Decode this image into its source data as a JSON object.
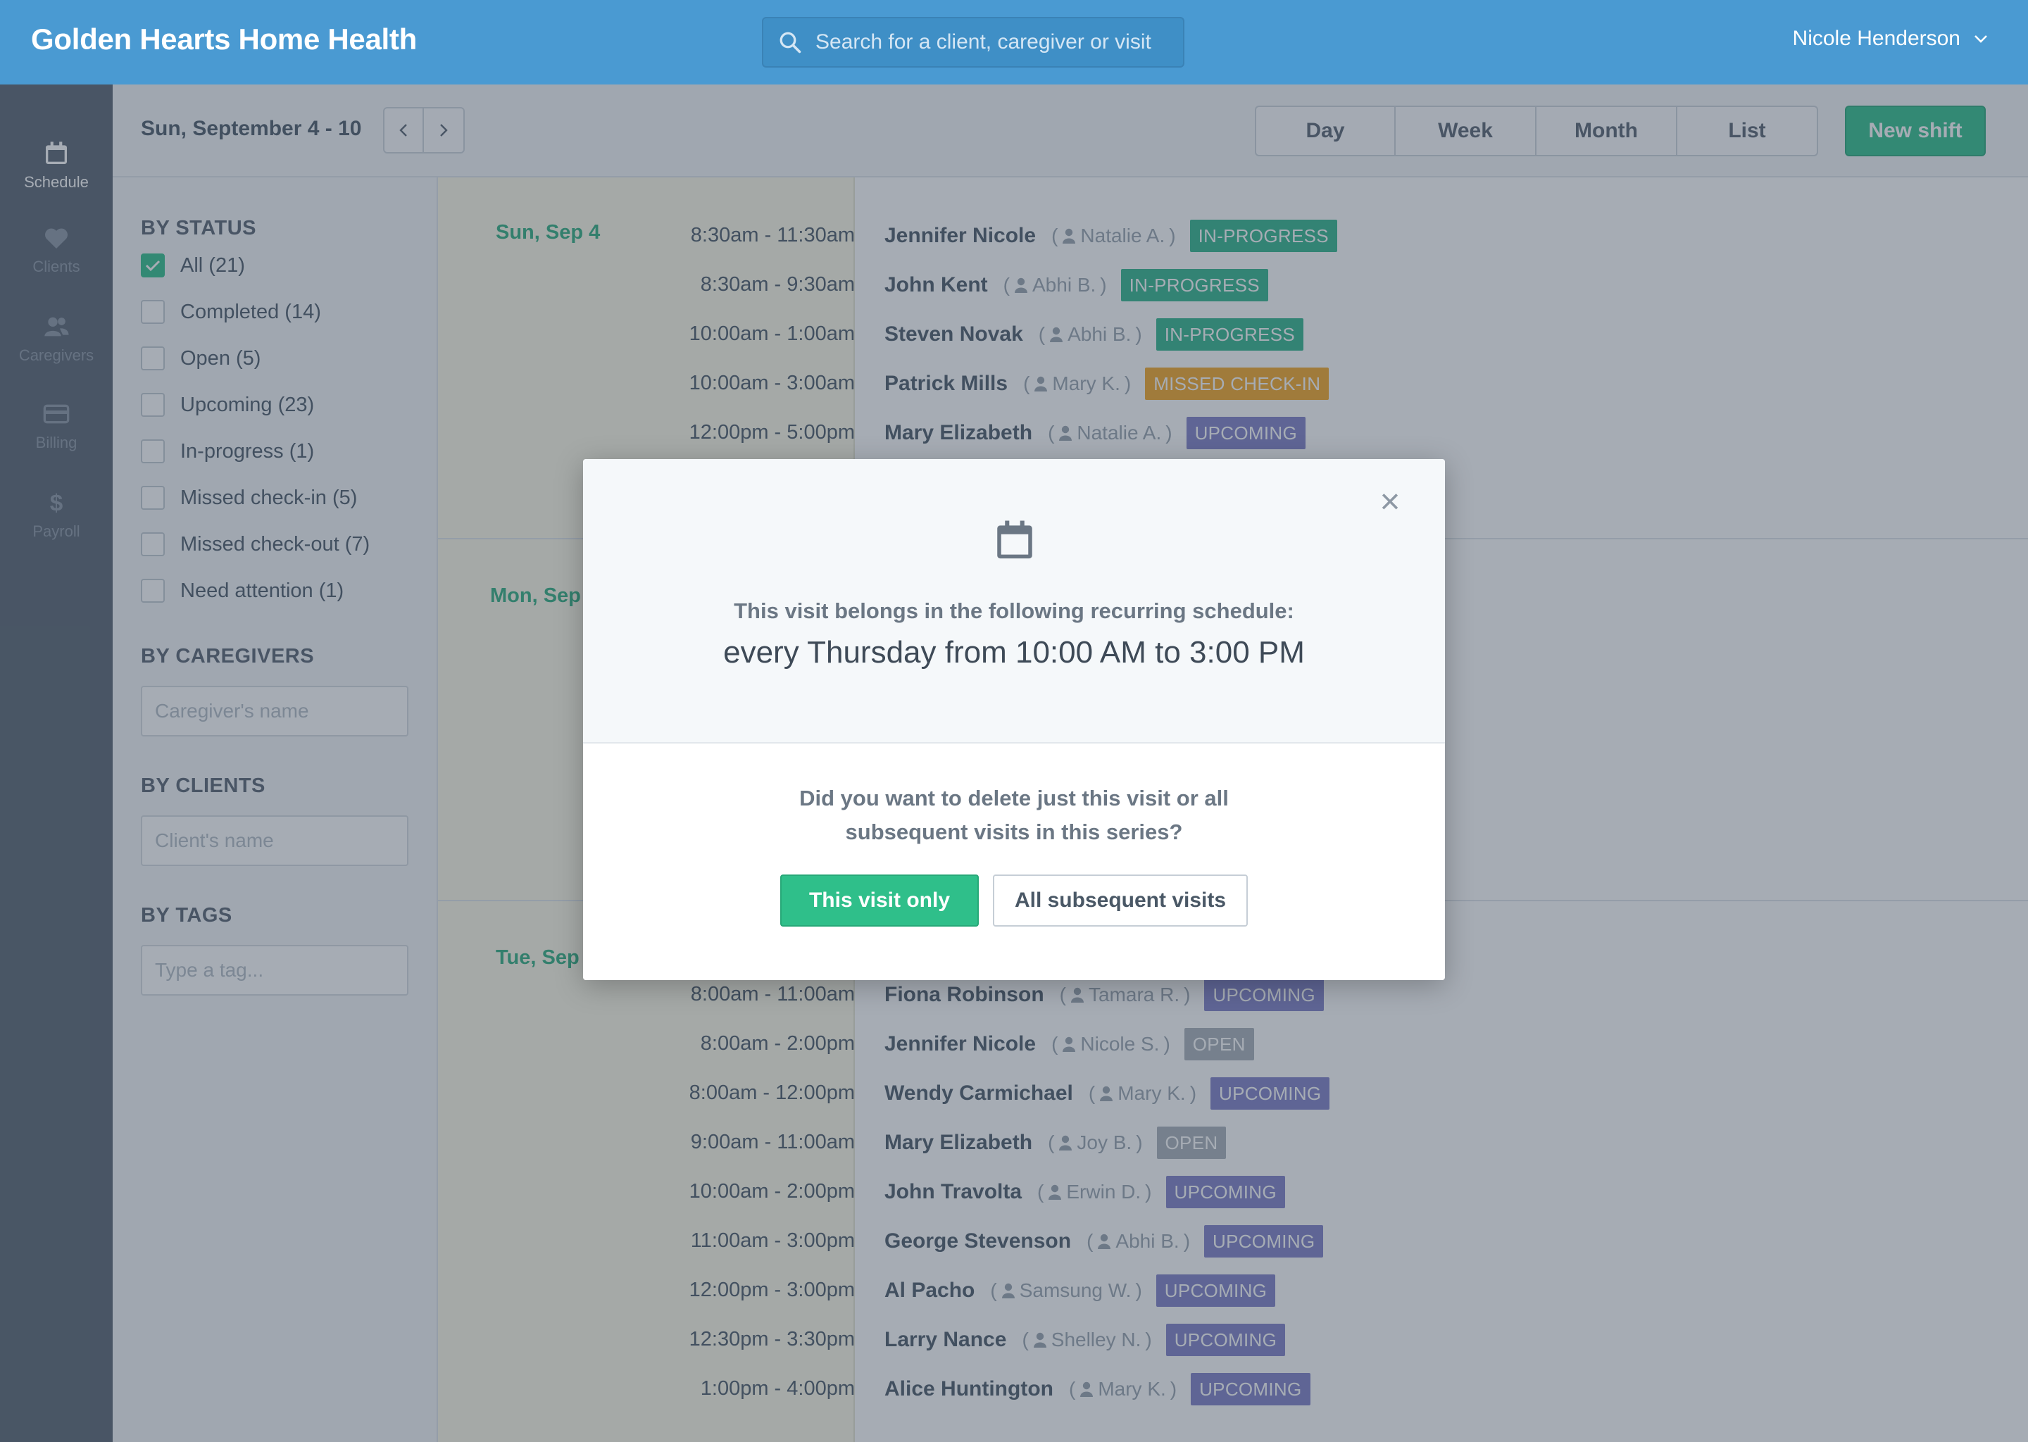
{
  "header": {
    "brand": "Golden Hearts Home Health",
    "search_placeholder": "Search for a client, caregiver or visit",
    "user_name": "Nicole Henderson"
  },
  "rail": [
    {
      "label": "Schedule",
      "icon": "calendar-icon",
      "active": true
    },
    {
      "label": "Clients",
      "icon": "heart-icon",
      "active": false
    },
    {
      "label": "Caregivers",
      "icon": "people-icon",
      "active": false
    },
    {
      "label": "Billing",
      "icon": "credit-card-icon",
      "active": false
    },
    {
      "label": "Payroll",
      "icon": "dollar-icon",
      "active": false
    }
  ],
  "toolbar": {
    "date_range": "Sun, September 4 - 10",
    "views": [
      "Day",
      "Week",
      "Month",
      "List"
    ],
    "new_shift": "New shift"
  },
  "filters": {
    "status_heading": "BY STATUS",
    "statuses": [
      {
        "label": "All (21)",
        "checked": true
      },
      {
        "label": "Completed (14)",
        "checked": false
      },
      {
        "label": "Open (5)",
        "checked": false
      },
      {
        "label": "Upcoming (23)",
        "checked": false
      },
      {
        "label": "In-progress (1)",
        "checked": false
      },
      {
        "label": "Missed check-in (5)",
        "checked": false
      },
      {
        "label": "Missed check-out (7)",
        "checked": false
      },
      {
        "label": "Need attention (1)",
        "checked": false
      }
    ],
    "caregivers_heading": "BY CAREGIVERS",
    "caregivers_placeholder": "Caregiver's name",
    "clients_heading": "BY CLIENTS",
    "clients_placeholder": "Client's name",
    "tags_heading": "BY TAGS",
    "tags_placeholder": "Type a tag..."
  },
  "status_colors": {
    "IN-PROGRESS": "#2fb58a",
    "MISSED CHECK-IN": "#f5a623",
    "UPCOMING": "#7e7fc6",
    "OPEN": "#a8b0b8"
  },
  "days": [
    {
      "label": "Sun, Sep 4",
      "visits": [
        {
          "time": "8:30am - 11:30am",
          "client": "Jennifer Nicole",
          "caregiver": "Natalie A.",
          "status": "IN-PROGRESS"
        },
        {
          "time": "8:30am - 9:30am",
          "client": "John Kent",
          "caregiver": "Abhi B.",
          "status": "IN-PROGRESS"
        },
        {
          "time": "10:00am - 1:00am",
          "client": "Steven Novak",
          "caregiver": "Abhi B.",
          "status": "IN-PROGRESS"
        },
        {
          "time": "10:00am - 3:00am",
          "client": "Patrick Mills",
          "caregiver": "Mary K.",
          "status": "MISSED CHECK-IN"
        },
        {
          "time": "12:00pm - 5:00pm",
          "client": "Mary Elizabeth",
          "caregiver": "Natalie A.",
          "status": "UPCOMING"
        }
      ]
    },
    {
      "label": "Mon, Sep",
      "visits": []
    },
    {
      "label": "Tue, Sep",
      "visits": [
        {
          "time": "8:00am - 11:00am",
          "client": "Fiona Robinson",
          "caregiver": "Tamara R.",
          "status": "UPCOMING"
        },
        {
          "time": "8:00am - 2:00pm",
          "client": "Jennifer Nicole",
          "caregiver": "Nicole S.",
          "status": "OPEN"
        },
        {
          "time": "8:00am - 12:00pm",
          "client": "Wendy Carmichael",
          "caregiver": "Mary K.",
          "status": "UPCOMING"
        },
        {
          "time": "9:00am - 11:00am",
          "client": "Mary Elizabeth",
          "caregiver": "Joy B.",
          "status": "OPEN"
        },
        {
          "time": "10:00am - 2:00pm",
          "client": "John Travolta",
          "caregiver": "Erwin D.",
          "status": "UPCOMING"
        },
        {
          "time": "11:00am - 3:00pm",
          "client": "George Stevenson",
          "caregiver": "Abhi B.",
          "status": "UPCOMING"
        },
        {
          "time": "12:00pm - 3:00pm",
          "client": "Al Pacho",
          "caregiver": "Samsung W.",
          "status": "UPCOMING"
        },
        {
          "time": "12:30pm - 3:30pm",
          "client": "Larry Nance",
          "caregiver": "Shelley N.",
          "status": "UPCOMING"
        },
        {
          "time": "1:00pm - 4:00pm",
          "client": "Alice Huntington",
          "caregiver": "Mary K.",
          "status": "UPCOMING"
        }
      ]
    }
  ],
  "modal": {
    "icon": "calendar-icon",
    "subtitle": "This visit belongs in the following recurring schedule:",
    "schedule": "every Thursday from 10:00 AM to 3:00 PM",
    "question_line1": "Did you want to delete just this visit or all",
    "question_line2": "subsequent visits in this series?",
    "primary": "This visit only",
    "secondary": "All subsequent visits",
    "close": "×"
  }
}
